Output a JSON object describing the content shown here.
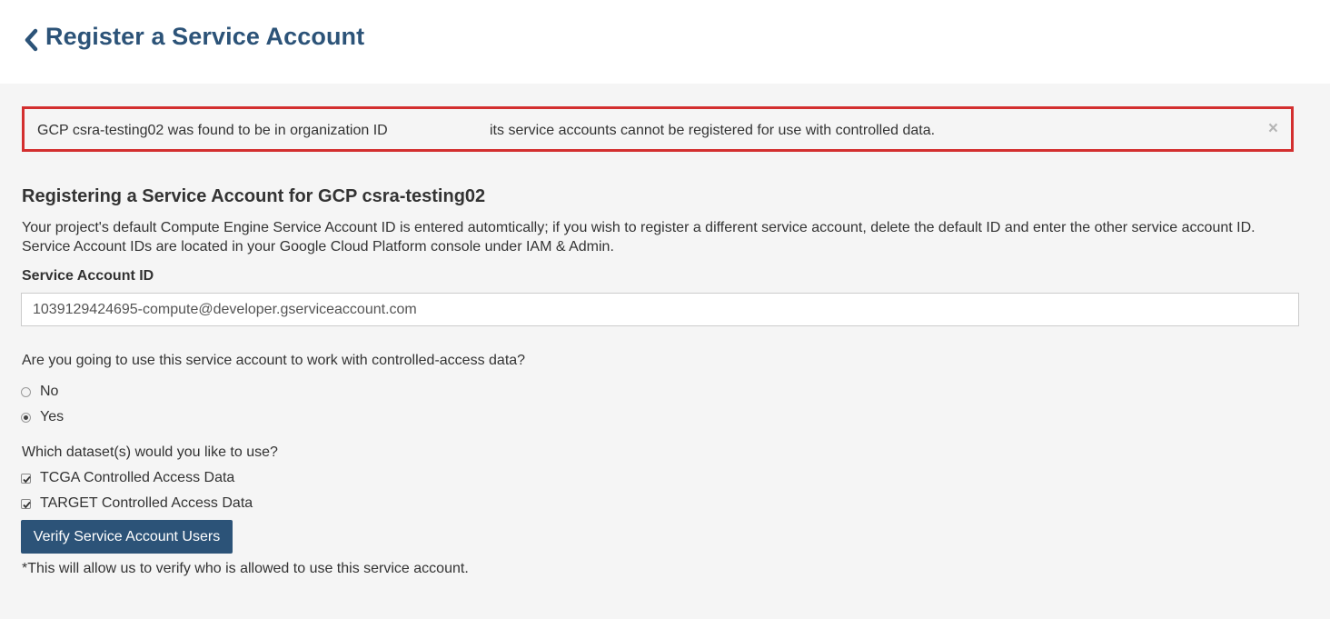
{
  "header": {
    "back_icon": "chevron-left-icon",
    "title": "Register a Service Account"
  },
  "alert": {
    "text_part1": "GCP csra-testing02 was found to be in organization ID",
    "text_part2": "its service accounts cannot be registered for use with controlled data.",
    "close": "×",
    "border_color": "#d32f2f"
  },
  "section": {
    "title": "Registering a Service Account for GCP csra-testing02",
    "description": "Your project's default Compute Engine Service Account ID is entered automtically; if you wish to register a different service account, delete the default ID and enter the other service account ID. Service Account IDs are located in your Google Cloud Platform console under IAM & Admin."
  },
  "service_account": {
    "label": "Service Account ID",
    "value": "1039129424695-compute@developer.gserviceaccount.com"
  },
  "controlled_access": {
    "question": "Are you going to use this service account to work with controlled-access data?",
    "options": [
      {
        "label": "No",
        "selected": false
      },
      {
        "label": "Yes",
        "selected": true
      }
    ]
  },
  "datasets": {
    "question": "Which dataset(s) would you like to use?",
    "options": [
      {
        "label": "TCGA Controlled Access Data",
        "checked": true
      },
      {
        "label": "TARGET Controlled Access Data",
        "checked": true
      }
    ]
  },
  "verify_button": {
    "label": "Verify Service Account Users",
    "color": "#2c5378"
  },
  "footnote": "*This will allow us to verify who is allowed to use this service account."
}
